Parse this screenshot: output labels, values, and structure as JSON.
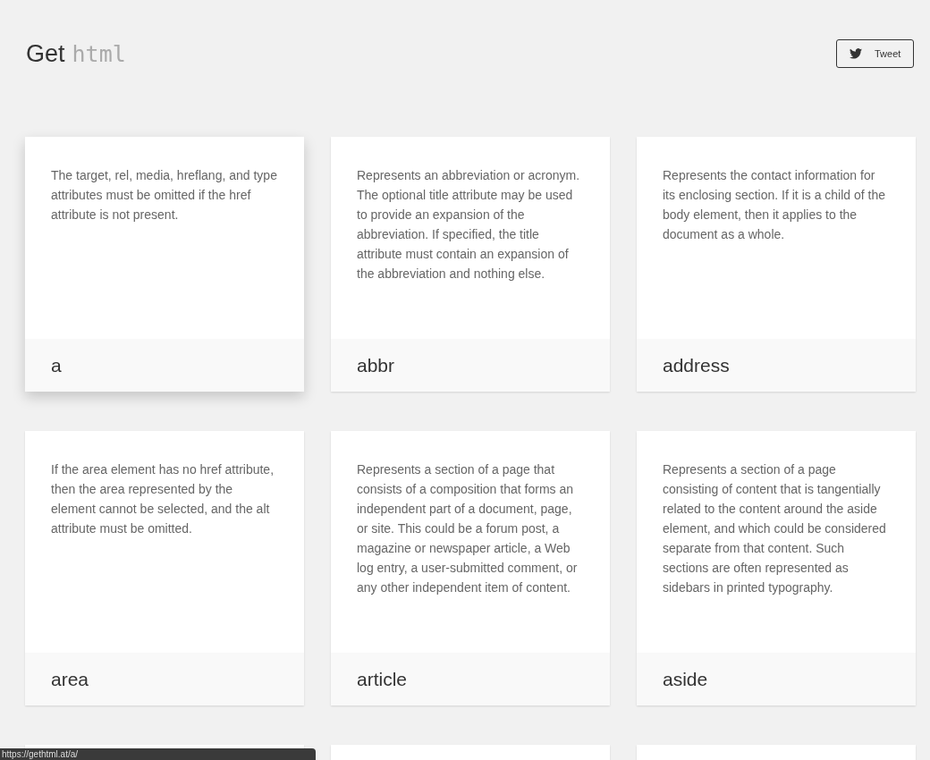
{
  "header": {
    "title": "Get",
    "title_code": "html",
    "tweet_button": "Tweet"
  },
  "cards": [
    {
      "kind": "full",
      "hovered": true,
      "description": "The target, rel, media, hreflang, and type attributes must be omitted if the href attribute is not present.",
      "name": "a"
    },
    {
      "kind": "full",
      "hovered": false,
      "description": "Represents an abbreviation or acronym. The optional title attribute may be used to provide an expansion of the abbreviation. If specified, the title attribute must contain an expansion of the abbreviation and nothing else.",
      "name": "abbr"
    },
    {
      "kind": "full",
      "hovered": false,
      "description": "Represents the contact information for its enclosing section. If it is a child of the body element, then it applies to the document as a whole.",
      "name": "address"
    },
    {
      "kind": "full",
      "hovered": false,
      "description": "If the area element has no href attribute, then the area represented by the element cannot be selected, and the alt attribute must be omitted.",
      "name": "area"
    },
    {
      "kind": "full",
      "hovered": false,
      "description": "Represents a section of a page that consists of a composition that forms an independent part of a document, page, or site. This could be a forum post, a magazine or newspaper article, a Web log entry, a user-submitted comment, or any other independent item of content.",
      "name": "article"
    },
    {
      "kind": "full",
      "hovered": false,
      "description": "Represents a section of a page consisting of content that is tangentially related to the content around the aside element, and which could be considered separate from that content. Such sections are often represented as sidebars in printed typography.",
      "name": "aside"
    },
    {
      "kind": "cut"
    },
    {
      "kind": "cut"
    },
    {
      "kind": "cut"
    }
  ],
  "status_bar": {
    "url": "https://gethtml.at/a/"
  }
}
